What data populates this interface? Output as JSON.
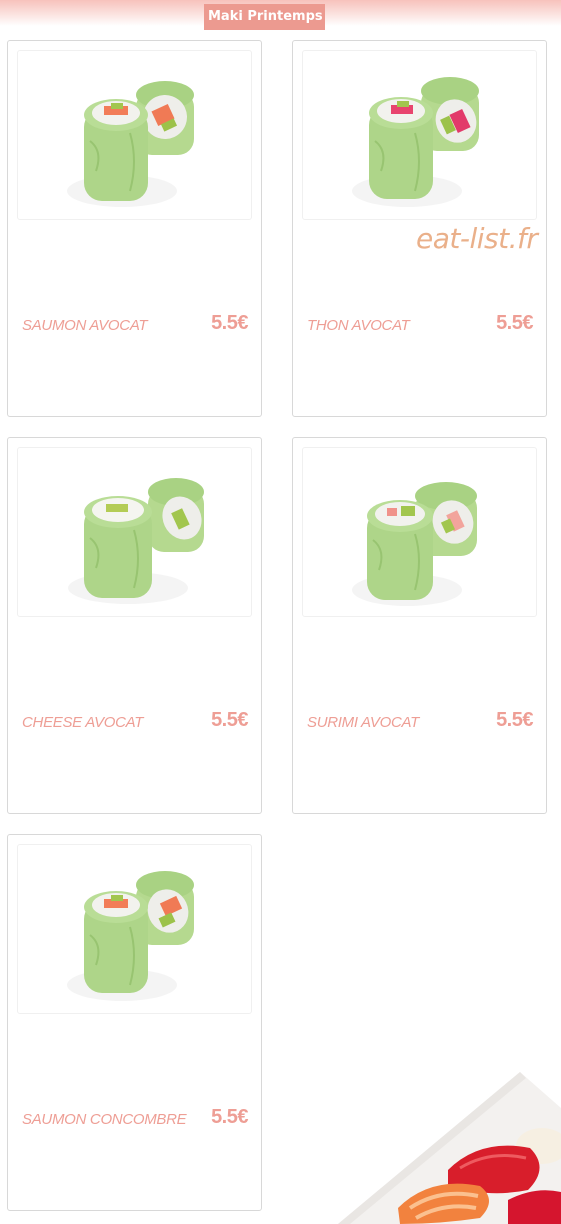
{
  "header": {
    "category_title": "Maki Printemps"
  },
  "watermark": {
    "text": "eat-list.fr"
  },
  "items": [
    {
      "name": "SAUMON AVOCAT",
      "price": "5.5€",
      "image": "maki-roll-photo"
    },
    {
      "name": "THON AVOCAT",
      "price": "5.5€",
      "image": "maki-roll-photo"
    },
    {
      "name": "CHEESE AVOCAT",
      "price": "5.5€",
      "image": "maki-roll-photo"
    },
    {
      "name": "SURIMI AVOCAT",
      "price": "5.5€",
      "image": "maki-roll-photo"
    },
    {
      "name": "SAUMON CONCOMBRE",
      "price": "5.5€",
      "image": "maki-roll-photo"
    }
  ],
  "colors": {
    "accent": "#ee9e95",
    "badge": "#ec9a90",
    "watermark": "#eab08a",
    "card_border": "#d8d8d8"
  }
}
